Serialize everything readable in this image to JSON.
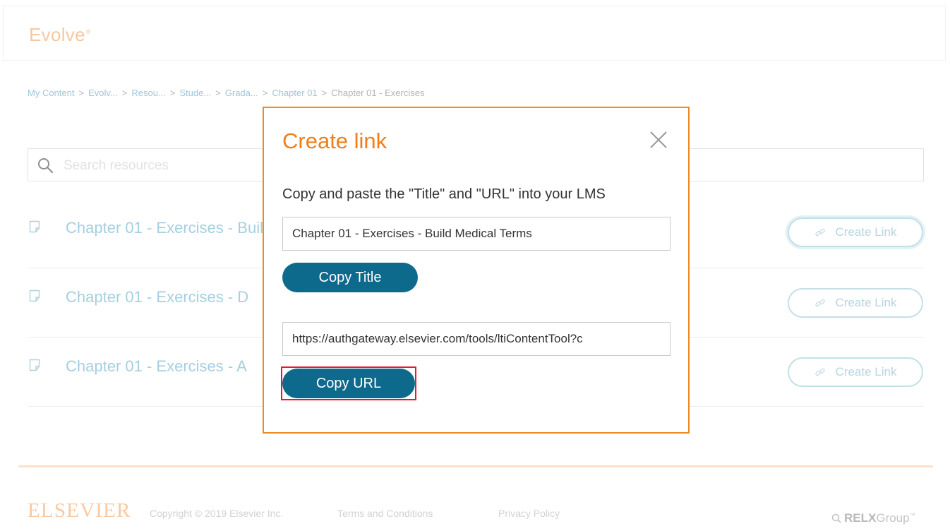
{
  "app": {
    "logo_text": "Evolve",
    "logo_mark": "®"
  },
  "breadcrumb": {
    "items": [
      "My Content",
      "Evolv...",
      "Resou...",
      "Stude...",
      "Grada...",
      "Chapter 01"
    ],
    "current": "Chapter 01 - Exercises",
    "separator": ">"
  },
  "search": {
    "placeholder": "Search resources"
  },
  "resources": [
    {
      "title": "Chapter 01 - Exercises - Build Medical Terms",
      "button_label": "Create Link"
    },
    {
      "title": "Chapter 01 - Exercises - D",
      "button_label": "Create Link"
    },
    {
      "title": "Chapter 01 - Exercises - A",
      "button_label": "Create Link"
    }
  ],
  "modal": {
    "title": "Create link",
    "instruction": "Copy and paste the \"Title\" and \"URL\" into your LMS",
    "title_value": "Chapter 01 - Exercises - Build Medical Terms",
    "copy_title_label": "Copy Title",
    "url_value": "https://authgateway.elsevier.com/tools/ltiContentTool?c",
    "copy_url_label": "Copy URL",
    "close_icon": "close-icon"
  },
  "footer": {
    "logo_text": "ELSEVIER",
    "copyright": "Copyright © 2019 Elsevier Inc.",
    "terms": "Terms and Conditions",
    "privacy": "Privacy Policy",
    "relx_bold": "RELX",
    "relx_rest": "Group",
    "relx_tm": "™"
  },
  "colors": {
    "accent_orange": "#ef7f1a",
    "button_blue": "#0e6a8d",
    "highlight_red": "#e8192c"
  }
}
